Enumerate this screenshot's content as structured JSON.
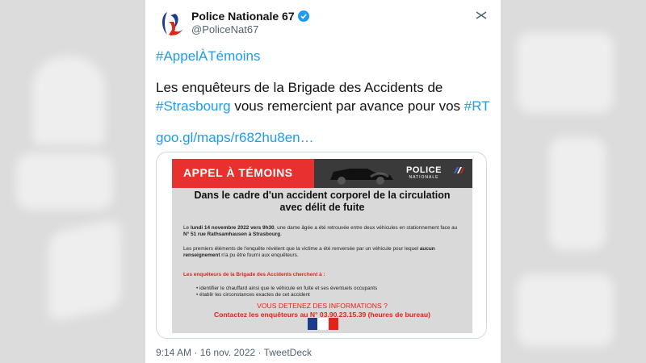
{
  "account": {
    "display_name": "Police Nationale 67",
    "handle": "@PoliceNat67",
    "verified": true,
    "avatar_icon": "police-nationale-logo",
    "more_icon": "more-options-icon"
  },
  "tweet": {
    "hashtag_line": "#AppelÀTémoins",
    "line1": "Les enquêteurs de la Brigade des Accidents de",
    "line2_link": "#Strasbourg",
    "line2_text": " vous remercient par avance pour vos ",
    "line2_tag": "#RT",
    "url": "goo.gl/maps/r682hu8en…"
  },
  "poster": {
    "title": "APPEL À TÉMOINS",
    "logo_text": "POLICE",
    "logo_sub": "NATIONALE",
    "subtitle1": "Dans le cadre d'un accident corporel de la circulation",
    "subtitle2": "avec délit de fuite",
    "p1_a": "Le ",
    "p1_b": "lundi 14 novembre 2022 vers 9h30",
    "p1_c": ", une dame âgée a été retrouvée entre deux véhicules en stationnement face au ",
    "p1_d": "N° 51 rue Rathsamhausen à Strasbourg",
    "p1_e": ".",
    "p2_a": "Les premiers éléments de l'enquête révèlent que la victime a été renversée par un véhicule pour lequel ",
    "p2_b": "aucun renseignement",
    "p2_c": " n'a pu être fourni aux enquêteurs.",
    "search_header": "Les enquêteurs de la Brigade des Accidents cherchent à :",
    "bullets": [
      "identifier le chauffard ainsi que le véhicule en fuite et ses éventuels occupants",
      "établir les circonstances exactes de cet accident"
    ],
    "cta1": "VOUS DETENEZ DES INFORMATIONS ?",
    "cta2": "Contactez les enquêteurs au N° 03.90.23.15.39 (heures de bureau)",
    "colors": {
      "red": "#e8312f",
      "dark": "#3a3a3a",
      "gray": "#d9d9d9"
    }
  },
  "meta": "9:14 AM · 16 nov. 2022 · TweetDeck",
  "colors": {
    "link": "#1d9bf0",
    "text": "#0f1419",
    "muted": "#536471"
  }
}
